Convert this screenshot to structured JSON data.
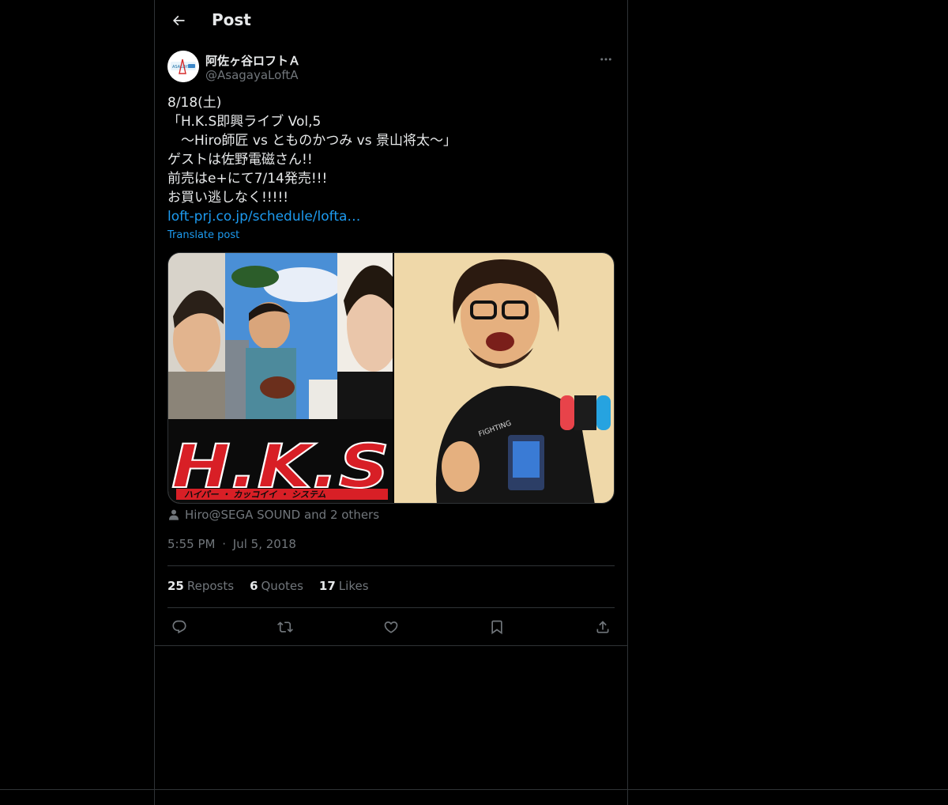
{
  "header": {
    "title": "Post",
    "back_icon": "arrow-left-icon"
  },
  "author": {
    "display_name": "阿佐ヶ谷ロフトＡ",
    "handle": "@AsagayaLoftA",
    "avatar_text": "ASAGAYA LOFT A"
  },
  "tweet": {
    "lines": [
      "8/18(土)",
      "「H.K.S即興ライブ Vol,5",
      "　～Hiro師匠 vs とものかつみ vs 景山将太～」",
      "ゲストは佐野電磁さん!!",
      "前売はe+にて7/14発売!!!",
      "お買い逃しなく!!!!!"
    ],
    "link": "loft-prj.co.jp/schedule/lofta…",
    "translate_label": "Translate post"
  },
  "media": {
    "logo_text": "H.K.S",
    "subtitle_text": "ハイパー ・ カッコイイ ・ システム",
    "shirt_text": "FIGHTING"
  },
  "tagged": {
    "text": "Hiro@SEGA SOUND and 2 others"
  },
  "meta": {
    "time": "5:55 PM",
    "separator": "·",
    "date": "Jul 5, 2018"
  },
  "stats": {
    "reposts_count": "25",
    "reposts_label": "Reposts",
    "quotes_count": "6",
    "quotes_label": "Quotes",
    "likes_count": "17",
    "likes_label": "Likes"
  },
  "colors": {
    "background": "#000000",
    "text": "#e7e9ea",
    "muted": "#71767b",
    "link": "#1d9bf0",
    "border": "#2f3336"
  }
}
